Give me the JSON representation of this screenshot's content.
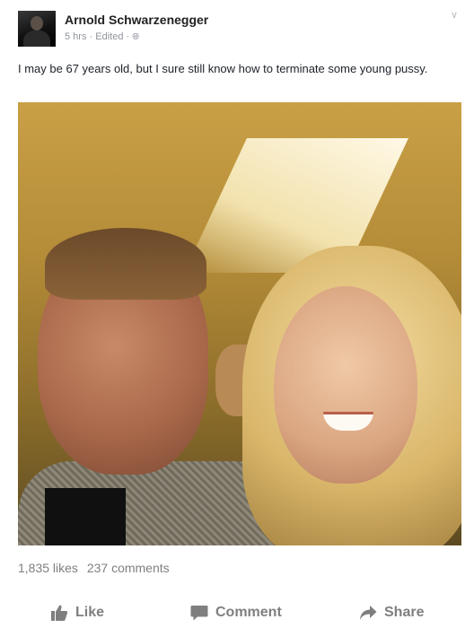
{
  "post": {
    "author": "Arnold Schwarzenegger",
    "time": "5 hrs",
    "edited": "Edited",
    "separator": "·",
    "text": "I may be 67 years old, but I sure still know how to terminate some young pussy."
  },
  "stats": {
    "likes": "1,835 likes",
    "comments": "237 comments"
  },
  "actions": {
    "like": "Like",
    "comment": "Comment",
    "share": "Share"
  },
  "colors": {
    "action_gray": "#7f7f7f",
    "meta_gray": "#90949c"
  },
  "icons": {
    "privacy": "globe-icon",
    "menu": "chevron-down-icon",
    "like": "thumbs-up-icon",
    "comment": "speech-bubble-icon",
    "share": "share-arrow-icon"
  }
}
